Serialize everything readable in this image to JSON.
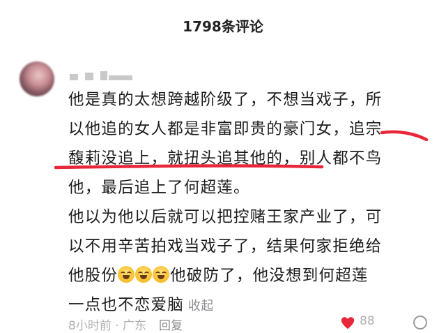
{
  "header": {
    "title": "1798条评论"
  },
  "comment": {
    "lines": [
      "他是真的太想跨越阶级了，不想当戏子，所",
      "以他追的女人都是非富即贵的豪门女，追宗",
      "馥莉没追上，就扭头追其他的，别人都不鸟",
      "他，最后追上了何超莲。",
      "他以为他以后就可以把控赌王家产业了，可",
      "以不用辛苦拍戏当戏子了，结果何家拒绝给",
      "一点也不恋爱脑"
    ],
    "emoji_line": {
      "prefix": "他股份",
      "suffix": "他破防了，他没想到何超莲"
    },
    "collapse_label": "收起"
  },
  "meta": {
    "time_location": "8小时前 · 广东",
    "reply_label": "回复"
  },
  "likes": {
    "count": "88"
  },
  "colors": {
    "highlight_underline": "#e8283a",
    "secondary_text": "#8e8e93"
  }
}
